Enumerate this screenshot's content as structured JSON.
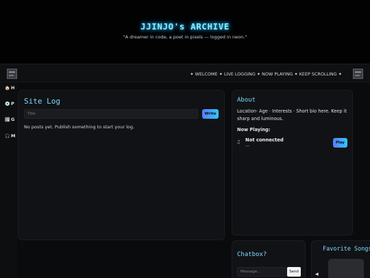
{
  "header": {
    "title": "JJINJO's ARCHIVE",
    "tagline": "\"A dreamer in code, a poet in pixels — logged in neon.\""
  },
  "nav": {
    "marquee": "✦ WELCOME ✦ LIVE LOGGING ✦ NOW PLAYING ✦ KEEP SCROLLING ✦"
  },
  "sidebar": {
    "items": [
      {
        "icon": "home-icon",
        "glyph": "🏠",
        "label": "H"
      },
      {
        "icon": "disc-icon",
        "glyph": "💿",
        "label": "P"
      },
      {
        "icon": "gallery-icon",
        "glyph": "🖼",
        "label": "G"
      },
      {
        "icon": "headphones-icon",
        "glyph": "🎧",
        "label": "M"
      }
    ]
  },
  "log": {
    "title": "Site Log",
    "title_placeholder": "Title",
    "write_label": "Write",
    "empty_message": "No posts yet. Publish something to start your log."
  },
  "about": {
    "title": "About",
    "bio": "Location· Age · Interests · Short bio here. Keep it sharp and luminous.",
    "now_playing_label": "Now Playing:",
    "track_icon": "♫",
    "track_title": "Not connected",
    "track_sub": "—",
    "play_label": "Play"
  },
  "chat": {
    "title": "Chatbox?",
    "placeholder": "Message...",
    "send_label": "Send"
  },
  "favorites": {
    "title": "Favorite Songs",
    "prev_glyph": "◀"
  },
  "colors": {
    "accent": "#7fd9ff",
    "neon_glow": "#1ec8ff",
    "button_gradient_start": "#5a7cff",
    "button_gradient_end": "#2ec8ff",
    "background": "#0a0b0d",
    "card": "#111215"
  }
}
